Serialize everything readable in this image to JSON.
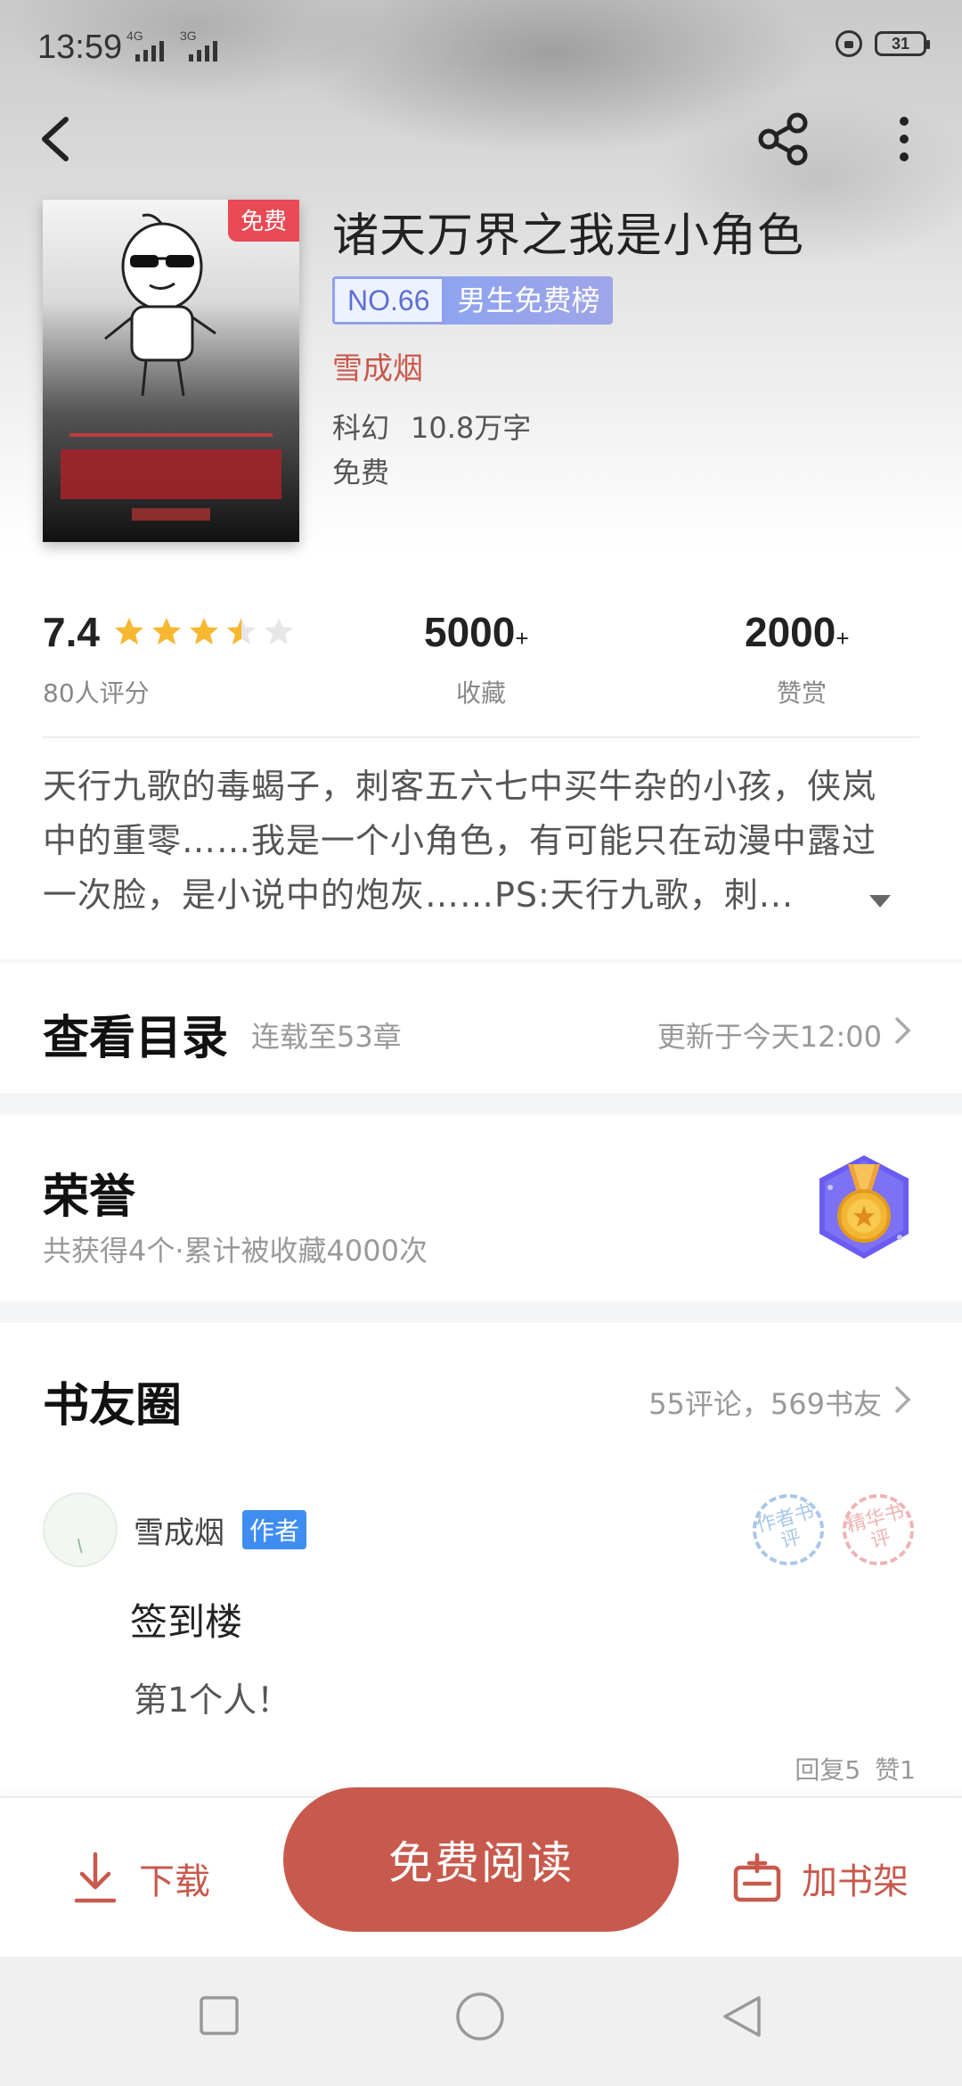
{
  "status_bar": {
    "time": "13:59",
    "network1": "4G",
    "network2": "3G",
    "battery": "31"
  },
  "nav": {
    "back_icon": "back-arrow-icon",
    "share_icon": "share-icon",
    "more_icon": "more-vertical-icon"
  },
  "book": {
    "cover_badge": "免费",
    "title": "诸天万界之我是小角色",
    "rank_no": "NO.66",
    "rank_name": "男生免费榜",
    "author": "雪成烟",
    "category": "科幻",
    "word_count": "10.8万字",
    "price": "免费"
  },
  "stats": {
    "score": "7.4",
    "rating_stars": 3.5,
    "rating_count": "80人评分",
    "favorites": "5000",
    "favorites_label": "收藏",
    "likes": "2000",
    "likes_label": "赞赏",
    "plus": "+"
  },
  "description": {
    "line1": "天行九歌的毒蝎子，刺客五六七中买牛杂的小孩，侠岚",
    "line2": "中的重零……我是一个小角色，有可能只在动漫中露过",
    "line3": "一次脸，是小说中的炮灰……PS:天行九歌，刺..."
  },
  "toc": {
    "title": "查看目录",
    "progress": "连载至53章",
    "updated": "更新于今天12:00"
  },
  "honor": {
    "title": "荣誉",
    "summary": "共获得4个·累计被收藏4000次"
  },
  "circle": {
    "title": "书友圈",
    "stats": "55评论，569书友",
    "post": {
      "author": "雪成烟",
      "author_tag": "作者",
      "stamp1": "作者书评",
      "stamp2": "精华书评",
      "title": "签到楼",
      "body": "第1个人！",
      "replies": "回复5",
      "likes": "赞1"
    }
  },
  "actions": {
    "download": "下载",
    "read": "免费阅读",
    "add_shelf": "加书架"
  },
  "colors": {
    "accent": "#c85a4d",
    "star": "#f7b731",
    "rank_blue": "#5b6fd6",
    "author_tag": "#3f8df0"
  }
}
